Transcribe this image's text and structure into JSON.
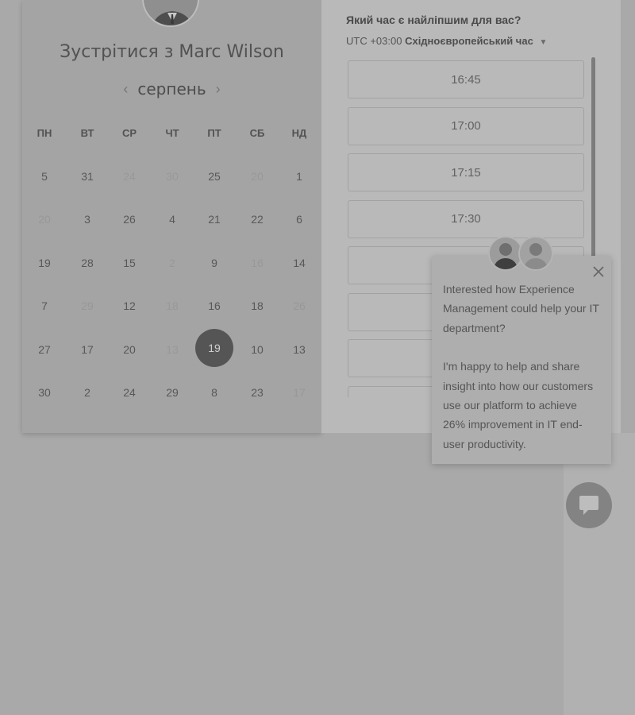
{
  "calendar": {
    "title": "Зустрітися з Marc Wilson",
    "month": "серпень",
    "weekdays": [
      "ПН",
      "ВТ",
      "СР",
      "ЧТ",
      "ПТ",
      "СБ",
      "НД"
    ],
    "weeks": [
      [
        {
          "d": "5",
          "m": false
        },
        {
          "d": "31",
          "m": false
        },
        {
          "d": "24",
          "m": true
        },
        {
          "d": "30",
          "m": true
        },
        {
          "d": "25",
          "m": false
        },
        {
          "d": "20",
          "m": true
        },
        {
          "d": "1",
          "m": false
        }
      ],
      [
        {
          "d": "20",
          "m": true
        },
        {
          "d": "3",
          "m": false
        },
        {
          "d": "26",
          "m": false
        },
        {
          "d": "4",
          "m": false
        },
        {
          "d": "21",
          "m": false
        },
        {
          "d": "22",
          "m": false
        },
        {
          "d": "6",
          "m": false
        }
      ],
      [
        {
          "d": "19",
          "m": false
        },
        {
          "d": "28",
          "m": false
        },
        {
          "d": "15",
          "m": false
        },
        {
          "d": "2",
          "m": true
        },
        {
          "d": "9",
          "m": false
        },
        {
          "d": "16",
          "m": true
        },
        {
          "d": "14",
          "m": false
        }
      ],
      [
        {
          "d": "7",
          "m": false
        },
        {
          "d": "29",
          "m": true
        },
        {
          "d": "12",
          "m": false
        },
        {
          "d": "18",
          "m": true
        },
        {
          "d": "16",
          "m": false
        },
        {
          "d": "18",
          "m": false
        },
        {
          "d": "26",
          "m": true
        }
      ],
      [
        {
          "d": "27",
          "m": false
        },
        {
          "d": "17",
          "m": false
        },
        {
          "d": "20",
          "m": false
        },
        {
          "d": "13",
          "m": true
        },
        {
          "d": "19",
          "m": false,
          "selected": true
        },
        {
          "d": "10",
          "m": false
        },
        {
          "d": "13",
          "m": false
        }
      ],
      [
        {
          "d": "30",
          "m": false
        },
        {
          "d": "2",
          "m": false
        },
        {
          "d": "24",
          "m": false
        },
        {
          "d": "29",
          "m": false
        },
        {
          "d": "8",
          "m": false
        },
        {
          "d": "23",
          "m": false
        },
        {
          "d": "17",
          "m": true
        }
      ]
    ]
  },
  "times": {
    "question": "Який час є найліпшим для вас?",
    "tz_offset": "UTC +03:00",
    "tz_name": "Східноєвропейський час",
    "slots": [
      "16:45",
      "17:00",
      "17:15",
      "17:30",
      "",
      "",
      "",
      ""
    ]
  },
  "chat": {
    "message_1": "Interested how Experience Management could help your IT department?",
    "message_2": "I'm happy to help and share insight into how our customers use our platform to achieve 26% improvement in IT end-user productivity."
  },
  "colors": {
    "selected_day": "#555555",
    "background": "#a9a9a9"
  }
}
